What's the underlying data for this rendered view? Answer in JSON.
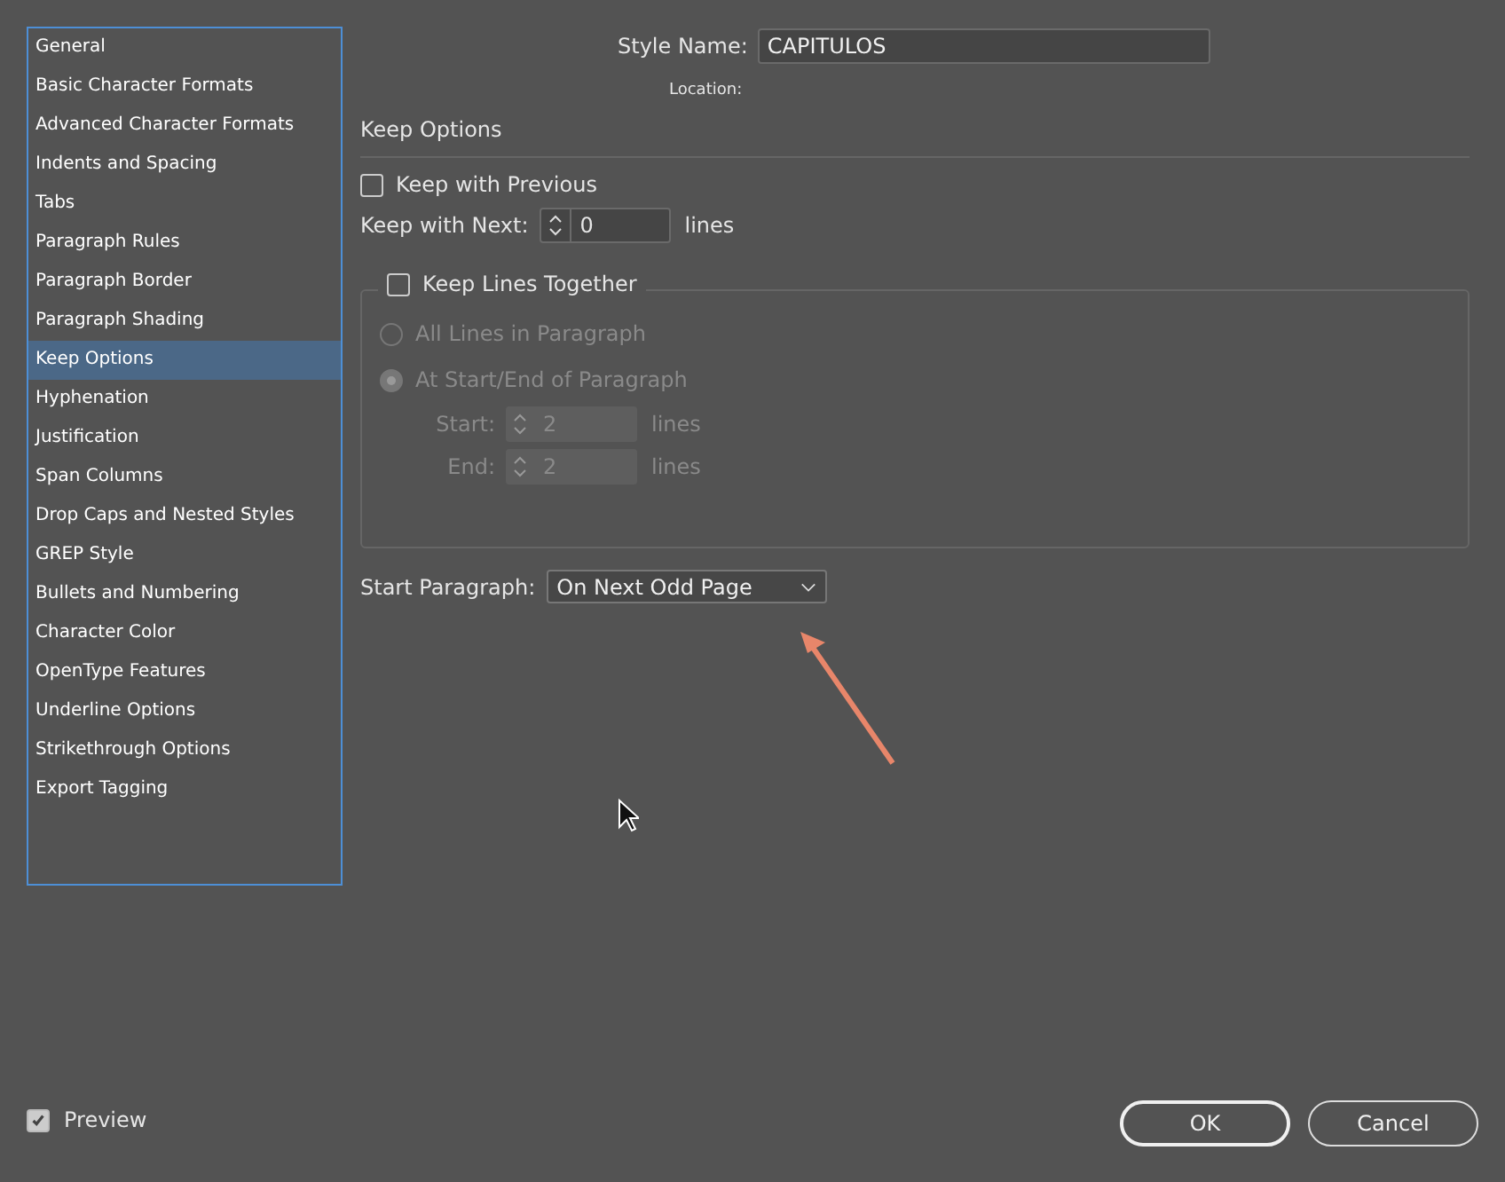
{
  "sidebar": {
    "items": [
      {
        "label": "General",
        "selected": false
      },
      {
        "label": "Basic Character Formats",
        "selected": false
      },
      {
        "label": "Advanced Character Formats",
        "selected": false
      },
      {
        "label": "Indents and Spacing",
        "selected": false
      },
      {
        "label": "Tabs",
        "selected": false
      },
      {
        "label": "Paragraph Rules",
        "selected": false
      },
      {
        "label": "Paragraph Border",
        "selected": false
      },
      {
        "label": "Paragraph Shading",
        "selected": false
      },
      {
        "label": "Keep Options",
        "selected": true
      },
      {
        "label": "Hyphenation",
        "selected": false
      },
      {
        "label": "Justification",
        "selected": false
      },
      {
        "label": "Span Columns",
        "selected": false
      },
      {
        "label": "Drop Caps and Nested Styles",
        "selected": false
      },
      {
        "label": "GREP Style",
        "selected": false
      },
      {
        "label": "Bullets and Numbering",
        "selected": false
      },
      {
        "label": "Character Color",
        "selected": false
      },
      {
        "label": "OpenType Features",
        "selected": false
      },
      {
        "label": "Underline Options",
        "selected": false
      },
      {
        "label": "Strikethrough Options",
        "selected": false
      },
      {
        "label": "Export Tagging",
        "selected": false
      }
    ]
  },
  "style_name": {
    "label": "Style Name:",
    "value": "CAPITULOS"
  },
  "location": {
    "label": "Location:"
  },
  "section_title": "Keep Options",
  "keep_with_previous": {
    "label": "Keep with Previous",
    "checked": false
  },
  "keep_with_next": {
    "label": "Keep with Next:",
    "value": "0",
    "unit": "lines"
  },
  "keep_lines_together": {
    "label": "Keep Lines Together",
    "checked": false,
    "options": [
      {
        "label": "All Lines in Paragraph",
        "selected": false,
        "disabled": true
      },
      {
        "label": "At Start/End of Paragraph",
        "selected": true,
        "disabled": true
      }
    ],
    "fields": [
      {
        "label": "Start:",
        "value": "2",
        "unit": "lines",
        "disabled": true
      },
      {
        "label": "End:",
        "value": "2",
        "unit": "lines",
        "disabled": true
      }
    ]
  },
  "start_paragraph": {
    "label": "Start Paragraph:",
    "value": "On Next Odd Page"
  },
  "preview": {
    "label": "Preview",
    "checked": true
  },
  "buttons": [
    {
      "label": "OK",
      "kind": "primary"
    },
    {
      "label": "Cancel",
      "kind": "secondary"
    }
  ]
}
